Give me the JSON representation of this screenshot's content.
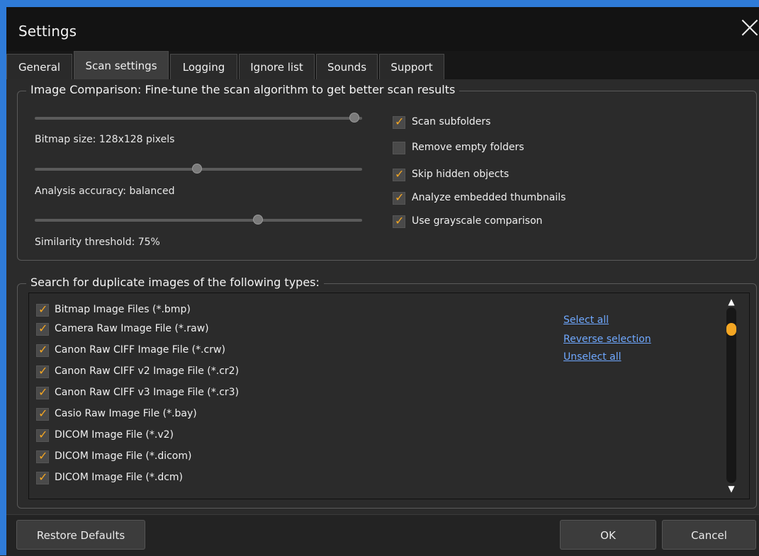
{
  "window": {
    "title": "Settings"
  },
  "tabs": [
    {
      "label": "General"
    },
    {
      "label": "Scan settings"
    },
    {
      "label": "Logging"
    },
    {
      "label": "Ignore list"
    },
    {
      "label": "Sounds"
    },
    {
      "label": "Support"
    }
  ],
  "active_tab": "Scan settings",
  "image_comparison": {
    "legend": "Image Comparison: Fine-tune the scan algorithm to get better scan results",
    "sliders": [
      {
        "label": "Bitmap size: 128x128 pixels",
        "value_fraction": 1.0
      },
      {
        "label": "Analysis accuracy: balanced",
        "value_fraction": 0.5
      },
      {
        "label": "Similarity threshold: 75%",
        "value_fraction": 0.68
      }
    ],
    "options": [
      {
        "label": "Scan subfolders",
        "checked": true
      },
      {
        "label": "Remove empty folders",
        "checked": false
      },
      {
        "label": "Skip hidden objects",
        "checked": true
      },
      {
        "label": "Analyze embedded thumbnails",
        "checked": true
      },
      {
        "label": "Use grayscale comparison",
        "checked": true
      }
    ]
  },
  "file_types": {
    "legend": "Search for duplicate images of the following types:",
    "items": [
      {
        "label": "Bitmap Image Files (*.bmp)",
        "checked": true
      },
      {
        "label": "Camera Raw Image File (*.raw)",
        "checked": true
      },
      {
        "label": "Canon Raw CIFF Image File (*.crw)",
        "checked": true
      },
      {
        "label": "Canon Raw CIFF v2 Image File (*.cr2)",
        "checked": true
      },
      {
        "label": "Canon Raw CIFF v3 Image File (*.cr3)",
        "checked": true
      },
      {
        "label": "Casio Raw Image File (*.bay)",
        "checked": true
      },
      {
        "label": "DICOM Image File (*.v2)",
        "checked": true
      },
      {
        "label": "DICOM Image File (*.dicom)",
        "checked": true
      },
      {
        "label": "DICOM Image File (*.dcm)",
        "checked": true
      }
    ],
    "links": {
      "select_all": "Select all",
      "reverse_selection": "Reverse selection",
      "unselect_all": "Unselect all"
    }
  },
  "buttons": {
    "restore_defaults": "Restore Defaults",
    "ok": "OK",
    "cancel": "Cancel"
  },
  "colors": {
    "accent": "#f4a623",
    "link": "#6fa8ff",
    "window_border": "#2f7bd8"
  }
}
